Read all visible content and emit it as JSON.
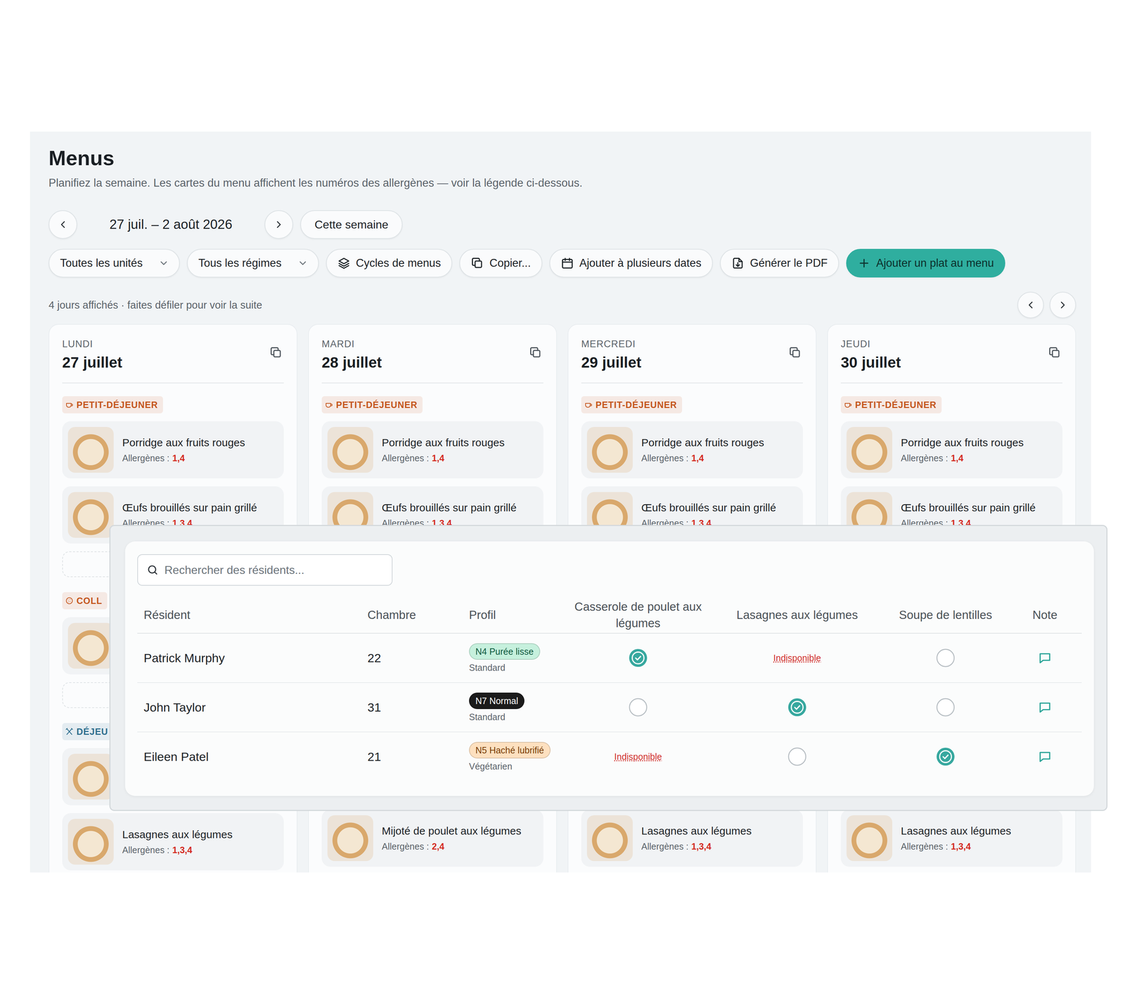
{
  "page": {
    "title": "Menus",
    "subtitle": "Planifiez la semaine. Les cartes du menu affichent les numéros des allergènes — voir la légende ci-dessous."
  },
  "week_nav": {
    "range": "27 juil. – 2 août 2026",
    "today_button": "Cette semaine"
  },
  "toolbar": [
    {
      "label": "Toutes les unités",
      "kind": "dropdown"
    },
    {
      "label": "Tous les régimes",
      "kind": "dropdown"
    },
    {
      "label": "Cycles de menus",
      "kind": "button"
    },
    {
      "label": "Copier...",
      "kind": "button"
    },
    {
      "label": "Ajouter à plusieurs dates",
      "kind": "button"
    },
    {
      "label": "Générer le PDF",
      "kind": "button"
    },
    {
      "label": "Ajouter un plat au menu",
      "kind": "primary"
    }
  ],
  "days_info": "4 jours affichés · faites défiler pour voir la suite",
  "days": [
    {
      "weekday": "LUNDI",
      "date": "27 juillet",
      "items": [
        {
          "kind": "breakfast",
          "label": "PETIT-DÉJEUNER",
          "color": "#c4561d"
        },
        {
          "kind": "dish",
          "name": "Porridge aux fruits rouges",
          "allergens_label": "Allergènes :",
          "allergens": "1,4"
        },
        {
          "kind": "dish",
          "name": "Œufs brouillés sur pain grillé",
          "allergens_label": "Allergènes :",
          "allergens": "1,3,4"
        },
        {
          "kind": "add"
        },
        {
          "kind": "snack",
          "label": "COLL",
          "color": "#c4561d"
        },
        {
          "kind": "dish"
        },
        {
          "kind": "add"
        },
        {
          "kind": "lunch",
          "label": "DÉJEU",
          "color": "#2d6e8e"
        },
        {
          "kind": "dish"
        },
        {
          "kind": "dish",
          "name": "Lasagnes aux légumes",
          "allergens_label": "Allergènes :",
          "allergens": "1,3,4"
        }
      ],
      "items_below": []
    },
    {
      "weekday": "MARDI",
      "date": "28 juillet",
      "items": [
        {
          "kind": "breakfast",
          "label": "PETIT-DÉJEUNER",
          "color": "#c4561d"
        },
        {
          "kind": "dish",
          "name": "Porridge aux fruits rouges",
          "allergens_label": "Allergènes :",
          "allergens": "1,4"
        },
        {
          "kind": "dish",
          "name": "Œufs brouillés sur pain grillé",
          "allergens_label": "Allergènes :",
          "allergens": "1,3,4"
        }
      ],
      "items_below": [
        {
          "kind": "dish",
          "name": "Mijoté de poulet aux légumes",
          "allergens_label": "Allergènes :",
          "allergens": "2,4"
        }
      ]
    },
    {
      "weekday": "MERCREDI",
      "date": "29 juillet",
      "items": [
        {
          "kind": "breakfast",
          "label": "PETIT-DÉJEUNER",
          "color": "#c4561d"
        },
        {
          "kind": "dish",
          "name": "Porridge aux fruits rouges",
          "allergens_label": "Allergènes :",
          "allergens": "1,4"
        },
        {
          "kind": "dish",
          "name": "Œufs brouillés sur pain grillé",
          "allergens_label": "Allergènes :",
          "allergens": "1,3,4"
        }
      ],
      "items_below": [
        {
          "kind": "dish",
          "name": "Lasagnes aux légumes",
          "allergens_label": "Allergènes :",
          "allergens": "1,3,4"
        }
      ]
    },
    {
      "weekday": "JEUDI",
      "date": "30 juillet",
      "items": [
        {
          "kind": "breakfast",
          "label": "PETIT-DÉJEUNER",
          "color": "#c4561d"
        },
        {
          "kind": "dish",
          "name": "Porridge aux fruits rouges",
          "allergens_label": "Allergènes :",
          "allergens": "1,4"
        },
        {
          "kind": "dish",
          "name": "Œufs brouillés sur pain grillé",
          "allergens_label": "Allergènes :",
          "allergens": "1,3,4"
        }
      ],
      "items_below": [
        {
          "kind": "dish",
          "name": "Lasagnes aux légumes",
          "allergens_label": "Allergènes :",
          "allergens": "1,3,4"
        }
      ]
    }
  ],
  "residents_panel": {
    "search_placeholder": "Rechercher des résidents...",
    "columns": [
      "Résident",
      "Chambre",
      "Profil",
      "Casserole de poulet aux légumes",
      "Lasagnes aux légumes",
      "Soupe de lentilles",
      "Note"
    ],
    "rows": [
      {
        "name": "Patrick Murphy",
        "room": "22",
        "profile": {
          "badge": "N4 Purée lisse",
          "color": "#c6f0dd",
          "text_color": "#0f5a3e",
          "diet": "Standard"
        },
        "choices": [
          {
            "kind": "radio",
            "selected": true
          },
          {
            "kind": "unavailable",
            "label": "Indisponible"
          },
          {
            "kind": "radio",
            "selected": false
          }
        ]
      },
      {
        "name": "John Taylor",
        "room": "31",
        "profile": {
          "badge": "N7 Normal",
          "color": "#1b1b1b",
          "text_color": "#ffffff",
          "diet": "Standard"
        },
        "choices": [
          {
            "kind": "radio",
            "selected": false
          },
          {
            "kind": "radio",
            "selected": true
          },
          {
            "kind": "radio",
            "selected": false
          }
        ]
      },
      {
        "name": "Eileen Patel",
        "room": "21",
        "profile": {
          "badge": "N5 Haché lubrifié",
          "color": "#fde0bf",
          "text_color": "#7a3d06",
          "diet": "Végétarien"
        },
        "choices": [
          {
            "kind": "unavailable",
            "label": "Indisponible"
          },
          {
            "kind": "radio",
            "selected": false
          },
          {
            "kind": "radio",
            "selected": true
          }
        ]
      }
    ]
  }
}
